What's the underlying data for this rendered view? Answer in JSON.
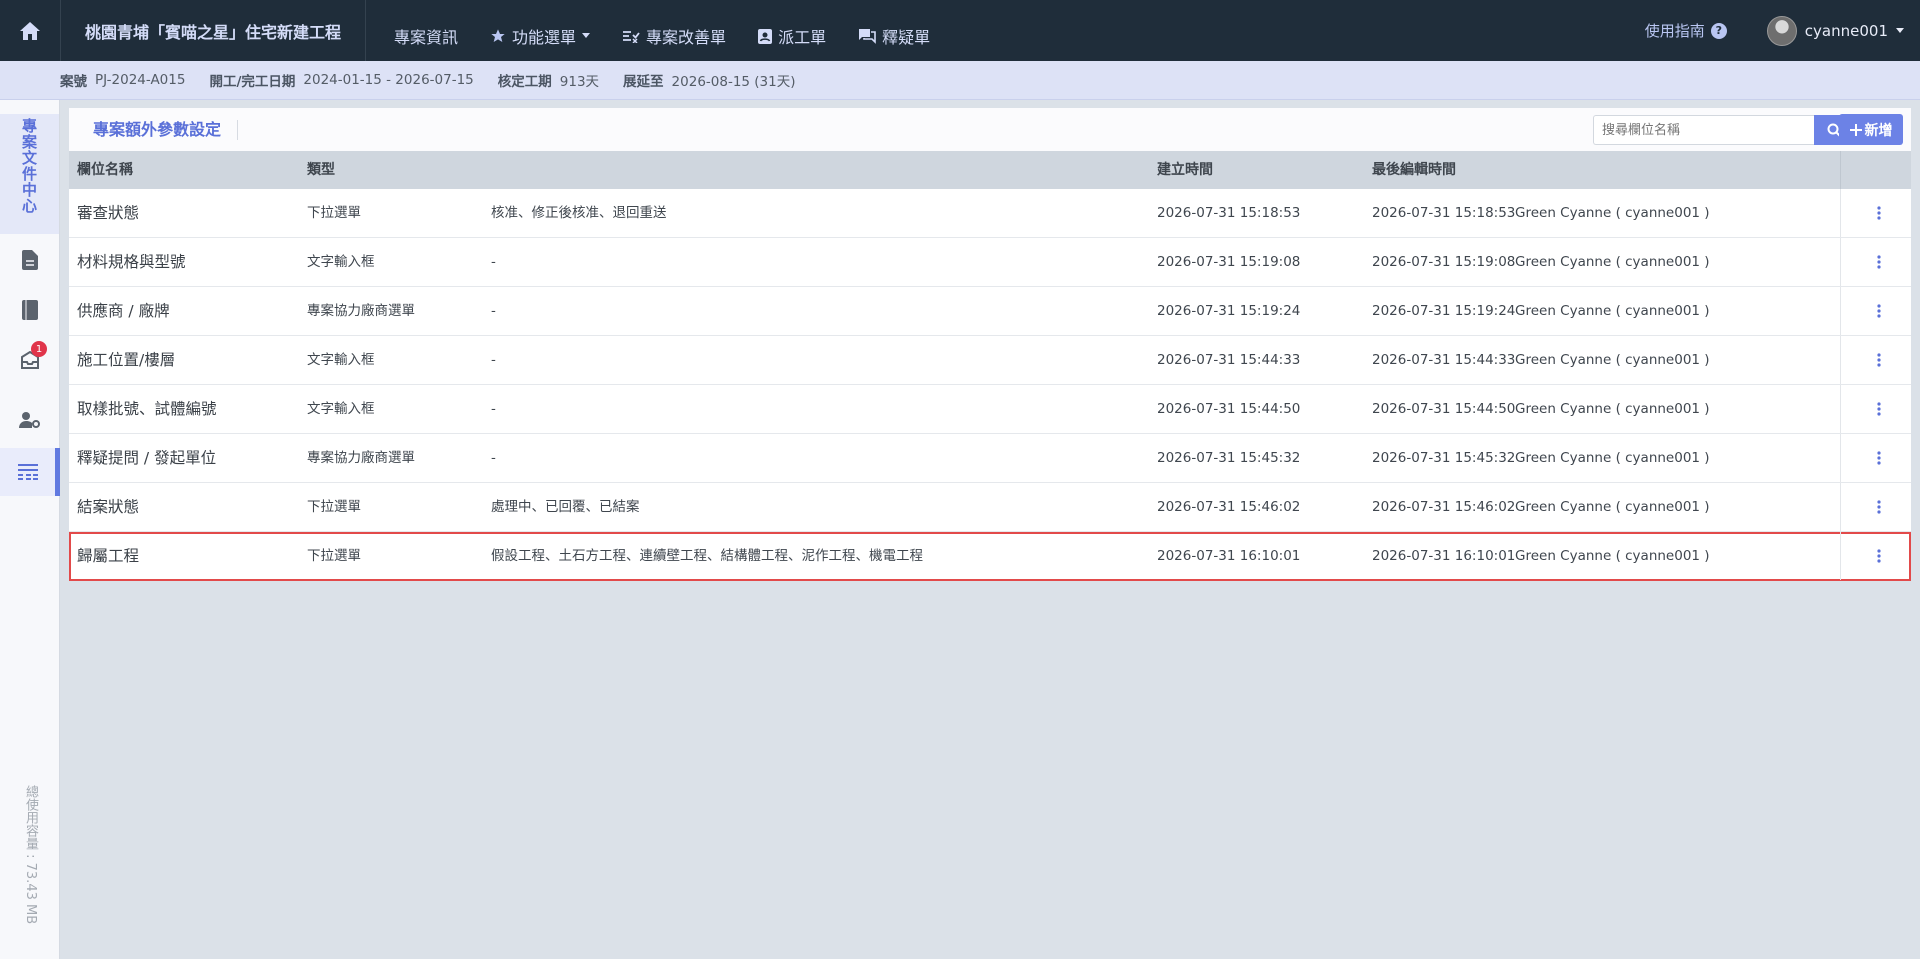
{
  "header": {
    "project_title": "桃園青埔「賓喵之星」住宅新建工程",
    "nav": [
      {
        "label": "專案資訊",
        "icon": ""
      },
      {
        "label": "功能選單",
        "icon": "star-icon"
      },
      {
        "label": "專案改善單",
        "icon": "checklist-icon"
      },
      {
        "label": "派工單",
        "icon": "badge-icon"
      },
      {
        "label": "釋疑單",
        "icon": "chat-icon"
      }
    ],
    "guide_label": "使用指南",
    "help_symbol": "?",
    "username": "cyanne001"
  },
  "infobar": {
    "case_label": "案號",
    "case_value": "PJ-2024-A015",
    "dates_label": "開工/完工日期",
    "dates_value": "2024-01-15 - 2026-07-15",
    "period_label": "核定工期",
    "period_value": "913天",
    "extend_label": "展延至",
    "extend_value": "2026-08-15 (31天)"
  },
  "sidebar": {
    "doc_center": "專案文件中心",
    "notification_count": "1",
    "storage": "總使用容量 : 73.43 MB"
  },
  "panel": {
    "title": "專案額外參數設定",
    "search_placeholder": "搜尋欄位名稱",
    "add_label": "新增"
  },
  "table": {
    "columns": [
      "欄位名稱",
      "類型",
      "建立時間",
      "最後編輯時間"
    ],
    "rows": [
      {
        "name": "審查狀態",
        "type": "下拉選單",
        "options": "核准、修正後核准、退回重送",
        "created": "2026-07-31 15:18:53",
        "edited": "2026-07-31 15:18:53",
        "editor": "Green Cyanne ( cyanne001 )"
      },
      {
        "name": "材料規格與型號",
        "type": "文字輸入框",
        "options": "-",
        "created": "2026-07-31 15:19:08",
        "edited": "2026-07-31 15:19:08",
        "editor": "Green Cyanne ( cyanne001 )"
      },
      {
        "name": "供應商 / 廠牌",
        "type": "專案協力廠商選單",
        "options": "-",
        "created": "2026-07-31 15:19:24",
        "edited": "2026-07-31 15:19:24",
        "editor": "Green Cyanne ( cyanne001 )"
      },
      {
        "name": "施工位置/樓層",
        "type": "文字輸入框",
        "options": "-",
        "created": "2026-07-31 15:44:33",
        "edited": "2026-07-31 15:44:33",
        "editor": "Green Cyanne ( cyanne001 )"
      },
      {
        "name": "取樣批號、試體編號",
        "type": "文字輸入框",
        "options": "-",
        "created": "2026-07-31 15:44:50",
        "edited": "2026-07-31 15:44:50",
        "editor": "Green Cyanne ( cyanne001 )"
      },
      {
        "name": "釋疑提問 / 發起單位",
        "type": "專案協力廠商選單",
        "options": "-",
        "created": "2026-07-31 15:45:32",
        "edited": "2026-07-31 15:45:32",
        "editor": "Green Cyanne ( cyanne001 )"
      },
      {
        "name": "結案狀態",
        "type": "下拉選單",
        "options": "處理中、已回覆、已結案",
        "created": "2026-07-31 15:46:02",
        "edited": "2026-07-31 15:46:02",
        "editor": "Green Cyanne ( cyanne001 )"
      },
      {
        "name": "歸屬工程",
        "type": "下拉選單",
        "options": "假設工程、土石方工程、連續壁工程、結構體工程、泥作工程、機電工程",
        "created": "2026-07-31 16:10:01",
        "edited": "2026-07-31 16:10:01",
        "editor": "Green Cyanne ( cyanne001 )"
      }
    ],
    "highlighted_row": 7
  },
  "colors": {
    "topbar": "#1f2d3a",
    "accent": "#6c82e6",
    "highlight_border": "#e24a4a",
    "badge": "#e0344a"
  }
}
